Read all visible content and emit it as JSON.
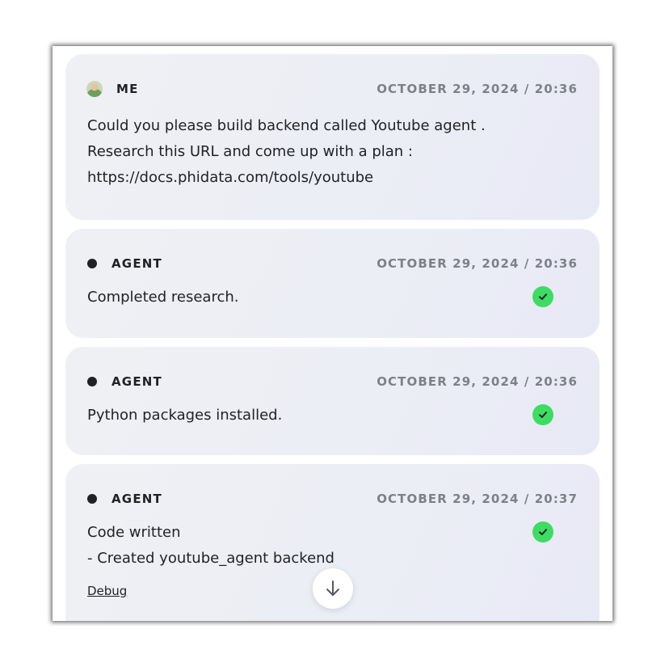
{
  "messages": [
    {
      "role": "ME",
      "timestamp": "OCTOBER 29, 2024 / 20:36",
      "lines": [
        "Could you please build backend called Youtube agent .",
        "Research this URL and come up with a plan :",
        "https://docs.phidata.com/tools/youtube"
      ]
    },
    {
      "role": "AGENT",
      "timestamp": "OCTOBER 29, 2024 / 20:36",
      "lines": [
        "Completed research."
      ],
      "status_icon": "check-circle-icon"
    },
    {
      "role": "AGENT",
      "timestamp": "OCTOBER 29, 2024 / 20:36",
      "lines": [
        "Python packages installed."
      ],
      "status_icon": "check-circle-icon"
    },
    {
      "role": "AGENT",
      "timestamp": "OCTOBER 29, 2024 / 20:37",
      "lines": [
        "Code written",
        "- Created youtube_agent backend"
      ],
      "status_icon": "check-circle-icon",
      "debug_link": "Debug"
    }
  ],
  "colors": {
    "check": "#3ddc62",
    "text": "#1f2125",
    "timestamp": "#7d8088"
  },
  "scroll_button_icon": "arrow-down-icon"
}
